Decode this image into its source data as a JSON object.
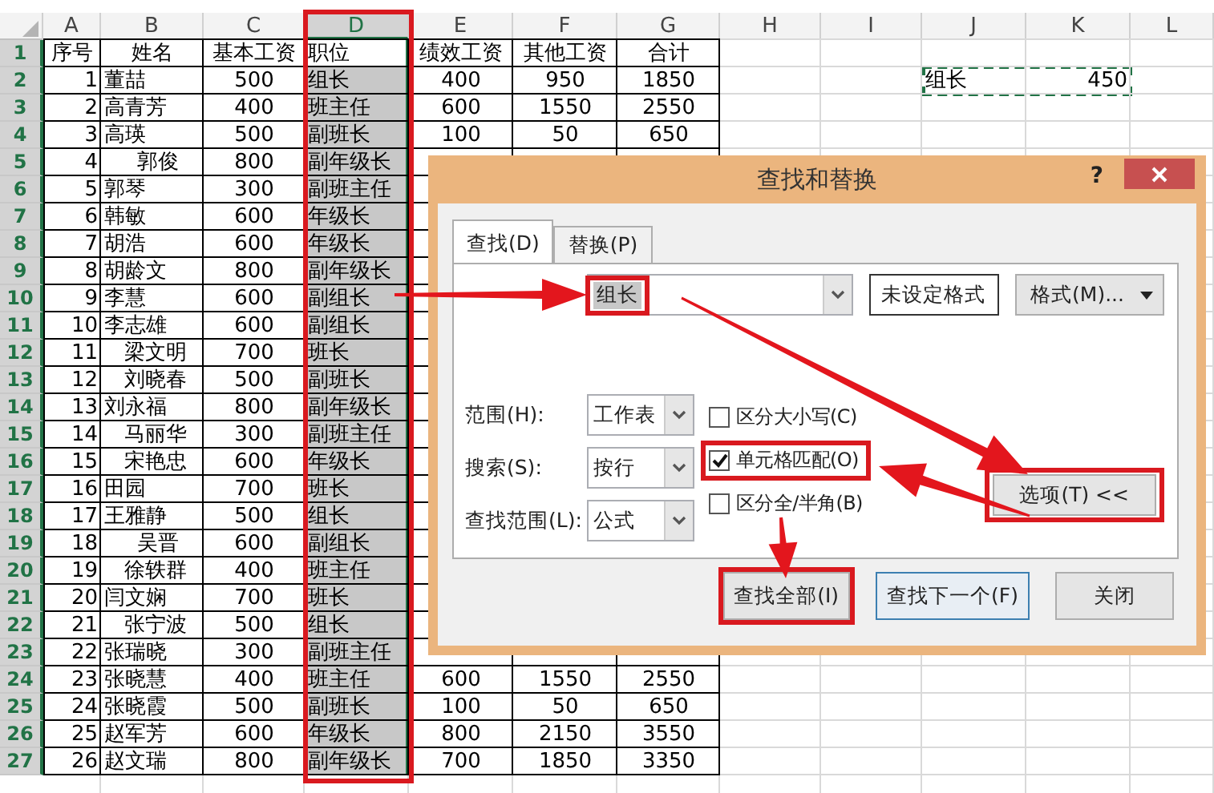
{
  "sheet": {
    "columns": [
      {
        "label": "A",
        "selected": false,
        "highlighted": false
      },
      {
        "label": "B",
        "selected": false,
        "highlighted": false
      },
      {
        "label": "C",
        "selected": false,
        "highlighted": false
      },
      {
        "label": "D",
        "selected": true,
        "highlighted": true
      },
      {
        "label": "E",
        "selected": false,
        "highlighted": false
      },
      {
        "label": "F",
        "selected": false,
        "highlighted": false
      },
      {
        "label": "G",
        "selected": false,
        "highlighted": false
      },
      {
        "label": "H",
        "selected": false,
        "highlighted": false
      },
      {
        "label": "I",
        "selected": false,
        "highlighted": false
      },
      {
        "label": "J",
        "selected": false,
        "highlighted": false
      },
      {
        "label": "K",
        "selected": false,
        "highlighted": false
      },
      {
        "label": "L",
        "selected": false,
        "highlighted": false
      }
    ],
    "rows": [
      {
        "header": "1",
        "cells": {
          "A": "序号",
          "B": "姓名",
          "C": "基本工资",
          "D": "职位",
          "E": "绩效工资",
          "F": "其他工资",
          "G": "合计"
        }
      },
      {
        "header": "2",
        "marquee": true,
        "cells": {
          "A": "1",
          "B": "董喆",
          "C": "500",
          "D": "组长",
          "E": "400",
          "F": "950",
          "G": "1850",
          "J": "组长",
          "K": "450"
        }
      },
      {
        "header": "3",
        "cells": {
          "A": "2",
          "B": "高青芳",
          "C": "400",
          "D": "班主任",
          "E": "600",
          "F": "1550",
          "G": "2550"
        }
      },
      {
        "header": "4",
        "cells": {
          "A": "3",
          "B": "高瑛",
          "C": "500",
          "D": "副班长",
          "E": "100",
          "F": "50",
          "G": "650"
        }
      },
      {
        "header": "5",
        "cells": {
          "A": "4",
          "B": "     郭俊",
          "C": "800",
          "D": "副年级长"
        }
      },
      {
        "header": "6",
        "cells": {
          "A": "5",
          "B": "郭琴",
          "C": "300",
          "D": "副班主任"
        }
      },
      {
        "header": "7",
        "cells": {
          "A": "6",
          "B": "韩敏",
          "C": "600",
          "D": "年级长"
        }
      },
      {
        "header": "8",
        "cells": {
          "A": "7",
          "B": "胡浩",
          "C": "600",
          "D": "年级长"
        }
      },
      {
        "header": "9",
        "cells": {
          "A": "8",
          "B": "胡龄文",
          "C": "800",
          "D": "副年级长"
        }
      },
      {
        "header": "10",
        "cells": {
          "A": "9",
          "B": "李慧",
          "C": "600",
          "D": "副组长"
        }
      },
      {
        "header": "11",
        "cells": {
          "A": "10",
          "B": "李志雄",
          "C": "600",
          "D": "副组长"
        }
      },
      {
        "header": "12",
        "cells": {
          "A": "11",
          "B": "   梁文明",
          "C": "700",
          "D": "班长"
        }
      },
      {
        "header": "13",
        "cells": {
          "A": "12",
          "B": "   刘晓春",
          "C": "500",
          "D": "副班长"
        }
      },
      {
        "header": "14",
        "cells": {
          "A": "13",
          "B": "刘永福",
          "C": "800",
          "D": "副年级长"
        }
      },
      {
        "header": "15",
        "cells": {
          "A": "14",
          "B": "   马丽华",
          "C": "300",
          "D": "副班主任"
        }
      },
      {
        "header": "16",
        "cells": {
          "A": "15",
          "B": "   宋艳忠",
          "C": "600",
          "D": "年级长"
        }
      },
      {
        "header": "17",
        "cells": {
          "A": "16",
          "B": "田园",
          "C": "700",
          "D": "班长"
        }
      },
      {
        "header": "18",
        "cells": {
          "A": "17",
          "B": "王雅静",
          "C": "500",
          "D": "组长"
        }
      },
      {
        "header": "19",
        "cells": {
          "A": "18",
          "B": "     吴晋",
          "C": "600",
          "D": "副组长"
        }
      },
      {
        "header": "20",
        "cells": {
          "A": "19",
          "B": "   徐轶群",
          "C": "400",
          "D": "班主任"
        }
      },
      {
        "header": "21",
        "cells": {
          "A": "20",
          "B": "闫文娴",
          "C": "700",
          "D": "班长"
        }
      },
      {
        "header": "22",
        "cells": {
          "A": "21",
          "B": "   张宁波",
          "C": "500",
          "D": "组长"
        }
      },
      {
        "header": "23",
        "cells": {
          "A": "22",
          "B": "张瑞晓",
          "C": "300",
          "D": "副班主任"
        }
      },
      {
        "header": "24",
        "cells": {
          "A": "23",
          "B": "张晓慧",
          "C": "400",
          "D": "班主任",
          "E": "600",
          "F": "1550",
          "G": "2550"
        }
      },
      {
        "header": "25",
        "cells": {
          "A": "24",
          "B": "张晓霞",
          "C": "500",
          "D": "副班长",
          "E": "100",
          "F": "50",
          "G": "650"
        }
      },
      {
        "header": "26",
        "cells": {
          "A": "25",
          "B": "赵军芳",
          "C": "600",
          "D": "年级长",
          "E": "800",
          "F": "2150",
          "G": "3550"
        }
      },
      {
        "header": "27",
        "cells": {
          "A": "26",
          "B": "赵文瑞",
          "C": "800",
          "D": "副年级长",
          "E": "700",
          "F": "1850",
          "G": "3350"
        }
      }
    ]
  },
  "dialog": {
    "title": "查找和替换",
    "help": "?",
    "tabs": [
      {
        "label": "查找(D)",
        "selected": true
      },
      {
        "label": "替换(P)",
        "selected": false
      }
    ],
    "find_what": {
      "value": "组长",
      "highlighted": true
    },
    "format_preview": "未设定格式",
    "format_button": "格式(M)...",
    "dropdowns": [
      {
        "label": "范围(H):",
        "value": "工作表"
      },
      {
        "label": "搜索(S):",
        "value": "按行"
      },
      {
        "label": "查找范围(L):",
        "value": "公式"
      }
    ],
    "checkboxes": [
      {
        "label": "区分大小写(C)",
        "checked": false,
        "highlighted": false
      },
      {
        "label": "单元格匹配(O)",
        "checked": true,
        "highlighted": true
      },
      {
        "label": "区分全/半角(B)",
        "checked": false,
        "highlighted": false
      }
    ],
    "options_button": {
      "label": "选项(T) <<",
      "highlighted": true
    },
    "buttons": [
      {
        "label": "查找全部(I)",
        "default": false,
        "highlighted": true
      },
      {
        "label": "查找下一个(F)",
        "default": true,
        "highlighted": false
      },
      {
        "label": "关闭",
        "default": false,
        "highlighted": false
      }
    ]
  }
}
